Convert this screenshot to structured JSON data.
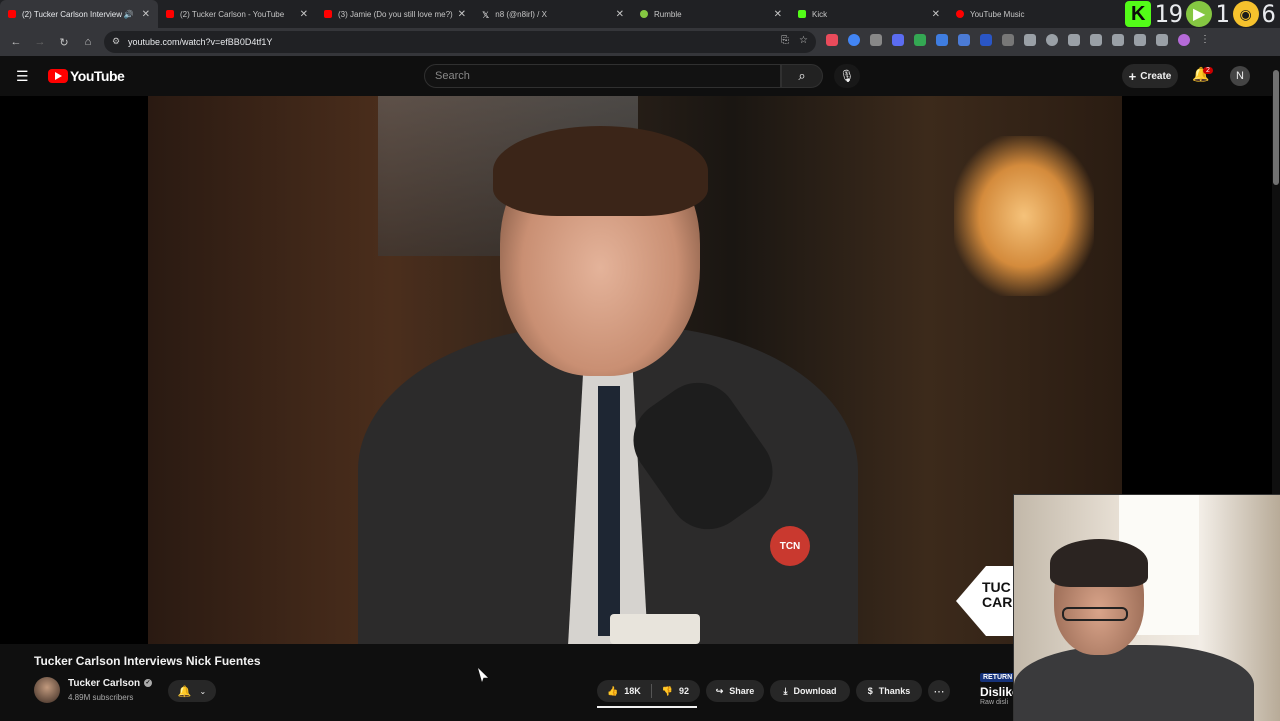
{
  "browser": {
    "tabs": [
      {
        "title": "(2) Tucker Carlson Interview",
        "favicon_color": "#ff0000",
        "active": true
      },
      {
        "title": "(2) Tucker Carlson - YouTube",
        "favicon_color": "#ff0000",
        "active": false
      },
      {
        "title": "(3) Jamie (Do you still love me?)",
        "favicon_color": "#ff0000",
        "active": false
      },
      {
        "title": "n8 (@n8irl) / X",
        "favicon_color": "#ffffff",
        "active": false
      },
      {
        "title": "Rumble",
        "favicon_color": "#85c742",
        "active": false
      },
      {
        "title": "Kick",
        "favicon_color": "#53fc18",
        "active": false
      },
      {
        "title": "YouTube Music",
        "favicon_color": "#ff0000",
        "active": false
      }
    ],
    "url": "youtube.com/watch?v=efBB0D4tf1Y",
    "ext_counters": {
      "kick": "K",
      "kick_count": "19",
      "rumble_count": "1",
      "other_count": "6"
    }
  },
  "youtube": {
    "logo_text": "YouTube",
    "search_placeholder": "Search",
    "create_label": "Create",
    "notification_count": "2",
    "avatar_letter": "N"
  },
  "video": {
    "overlay_logo": "TUC",
    "overlay_logo_line2": "CAR",
    "mic_badge": "TCN"
  },
  "meta": {
    "title": "Tucker Carlson Interviews Nick Fuentes",
    "channel_name": "Tucker Carlson",
    "subscribers": "4.89M subscribers",
    "likes": "18K",
    "dislikes": "92",
    "share_label": "Share",
    "download_label": "Download",
    "thanks_label": "Thanks",
    "ryd_tag": "RETURN",
    "ryd_title": "Dislike",
    "ryd_sub": "Raw disli"
  },
  "colors": {
    "youtube_red": "#ff0000",
    "kick_green": "#53fc18",
    "rumble_green": "#85c742"
  }
}
